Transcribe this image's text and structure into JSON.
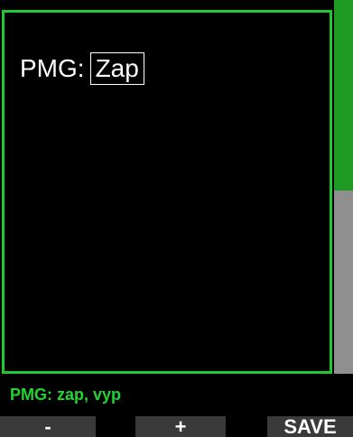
{
  "setting": {
    "label": "PMG:",
    "value": "Zap"
  },
  "hint": "PMG: zap, vyp",
  "softkeys": {
    "left": "-",
    "middle": "+",
    "right": "SAVE"
  },
  "scroll": {
    "position_fraction": 0.0,
    "visible_fraction": 0.51
  },
  "colors": {
    "accent": "#22c832",
    "hint_text": "#22d432",
    "scroll_thumb": "#1f9a22",
    "scroll_track": "#8f8f8f",
    "softkey_bg": "#3a3a3a"
  }
}
